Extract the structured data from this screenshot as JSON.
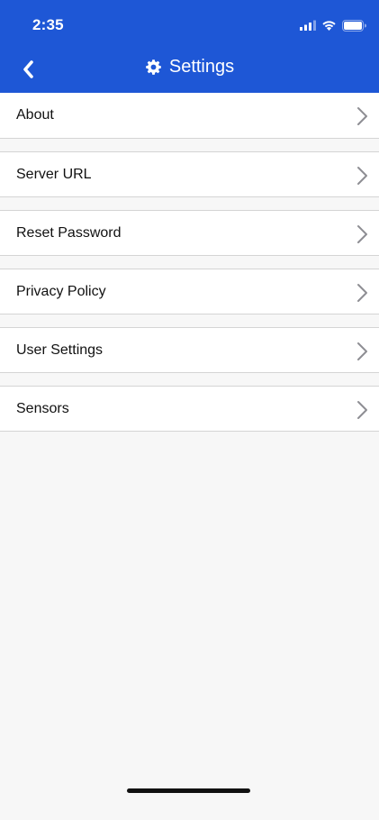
{
  "status_bar": {
    "time": "2:35",
    "icons": [
      "signal-icon",
      "wifi-icon",
      "battery-icon"
    ]
  },
  "nav": {
    "back_icon": "chevron-left-icon",
    "title_icon": "gear-icon",
    "title": "Settings"
  },
  "settings": {
    "items": [
      {
        "label": "About"
      },
      {
        "label": "Server URL"
      },
      {
        "label": "Reset Password"
      },
      {
        "label": "Privacy Policy"
      },
      {
        "label": "User Settings"
      },
      {
        "label": "Sensors"
      }
    ]
  },
  "colors": {
    "header_bg": "#1e57d6",
    "page_bg": "#f7f7f7",
    "row_bg": "#ffffff",
    "chevron": "#8e8e93"
  }
}
